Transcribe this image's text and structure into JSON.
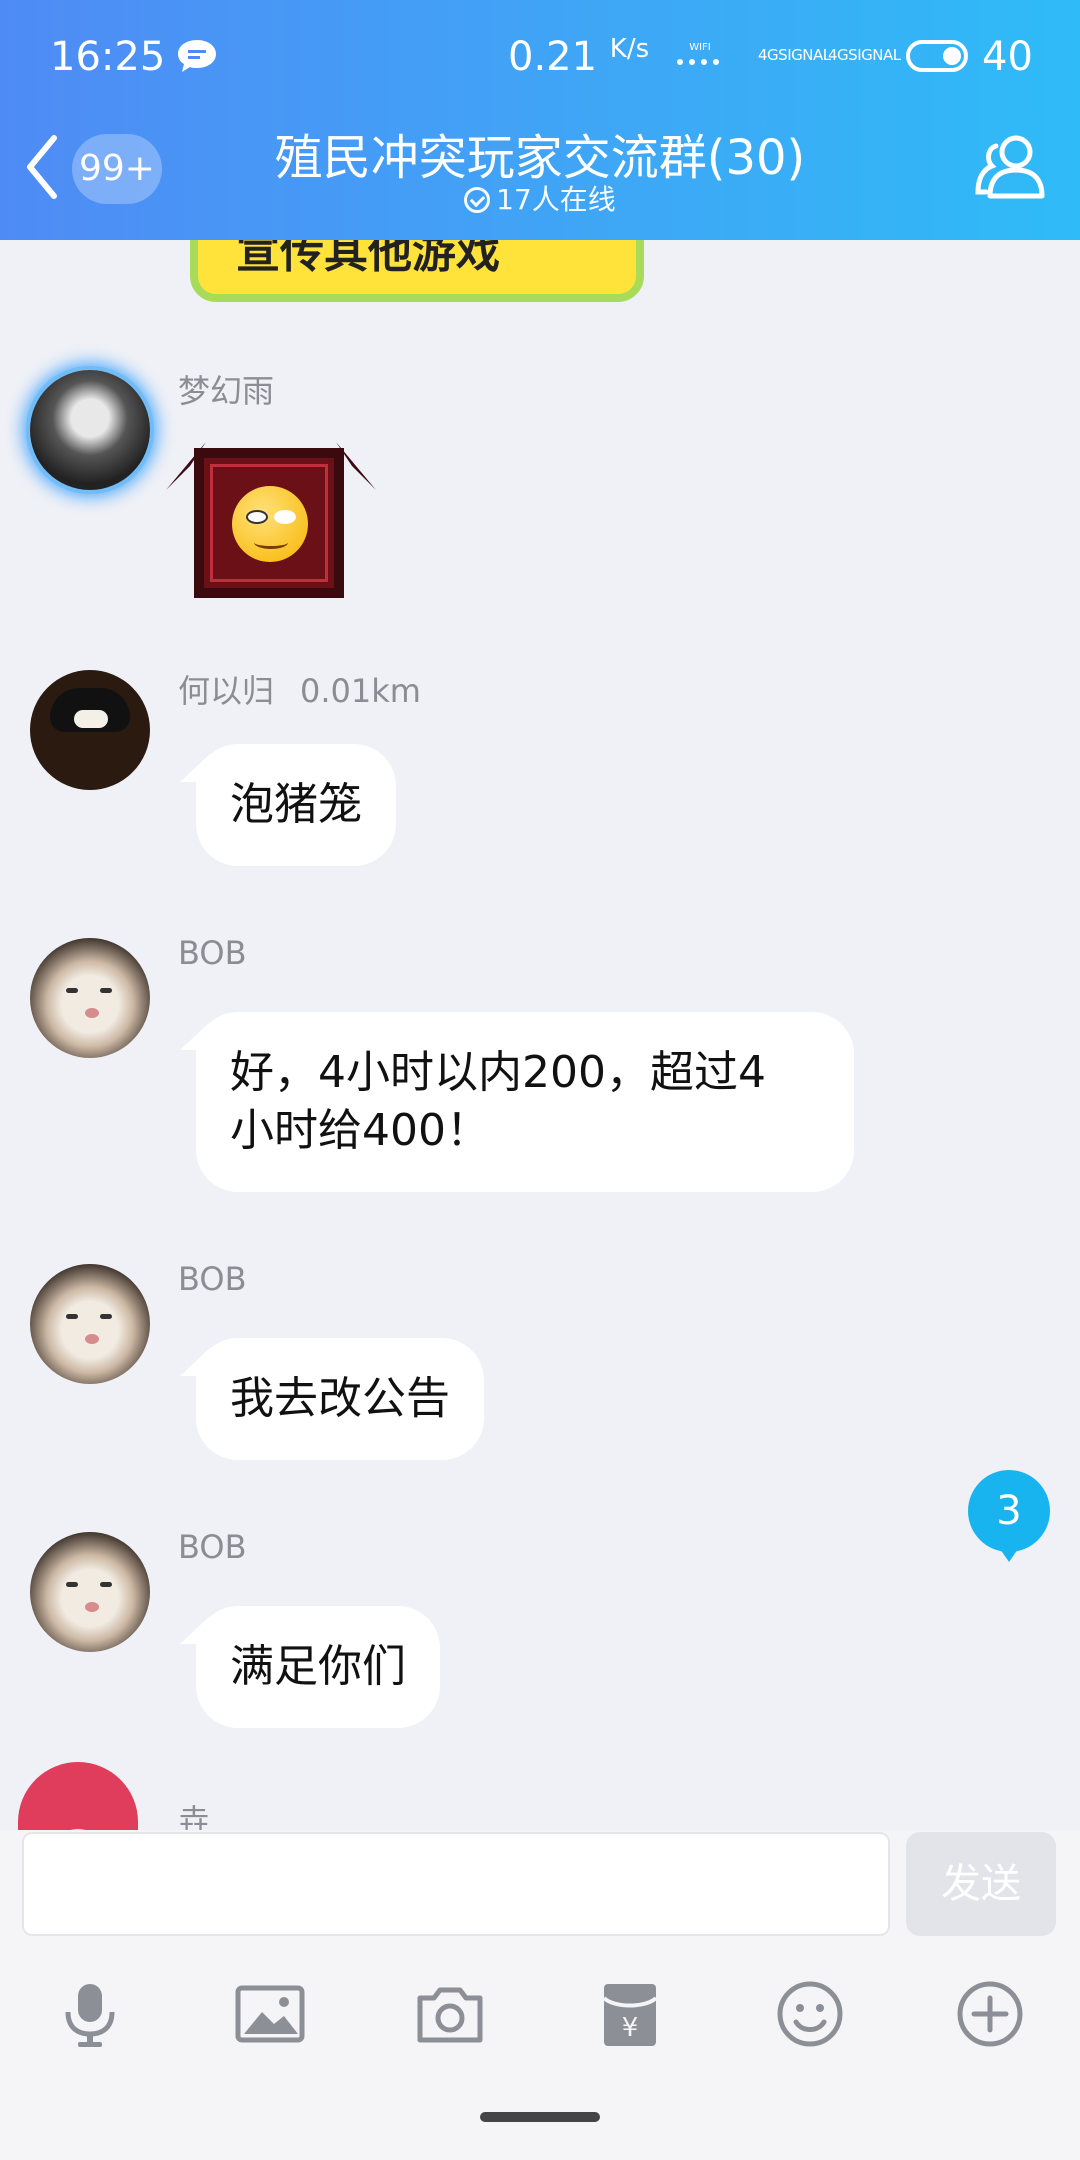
{
  "status_bar": {
    "time": "16:25",
    "speed": "0.21",
    "speed_unit": "K/s",
    "wifi_label": "WIFI",
    "signal1": "4GSIGNAL",
    "signal2": "4GSIGNAL",
    "battery": "40"
  },
  "header": {
    "unread_badge": "99+",
    "title": "殖民冲突玩家交流群(30)",
    "subtitle": "17人在线"
  },
  "messages": [
    {
      "sender": "梦幻雨",
      "type": "sticker"
    },
    {
      "sender": "何以归",
      "distance": "0.01km",
      "text": "泡猪笼"
    },
    {
      "sender": "BOB",
      "text_line1": "好，4小时以内200，超过4",
      "text_line2": "小时给400！"
    },
    {
      "sender": "BOB",
      "text": "我去改公告"
    },
    {
      "sender": "BOB",
      "text": "满足你们"
    },
    {
      "sender": "垚"
    }
  ],
  "previous_sticker_text": "宣传其他游戏",
  "unread_count": "3",
  "input": {
    "value": "",
    "send_label": "发送"
  },
  "toolbar": [
    "microphone-icon",
    "image-icon",
    "camera-icon",
    "red-packet-icon",
    "emoji-icon",
    "plus-icon"
  ],
  "colors": {
    "header_start": "#4f8bf5",
    "header_end": "#2fbbf7",
    "chat_bg": "#f0f1f6",
    "badge": "#18b4ef"
  }
}
